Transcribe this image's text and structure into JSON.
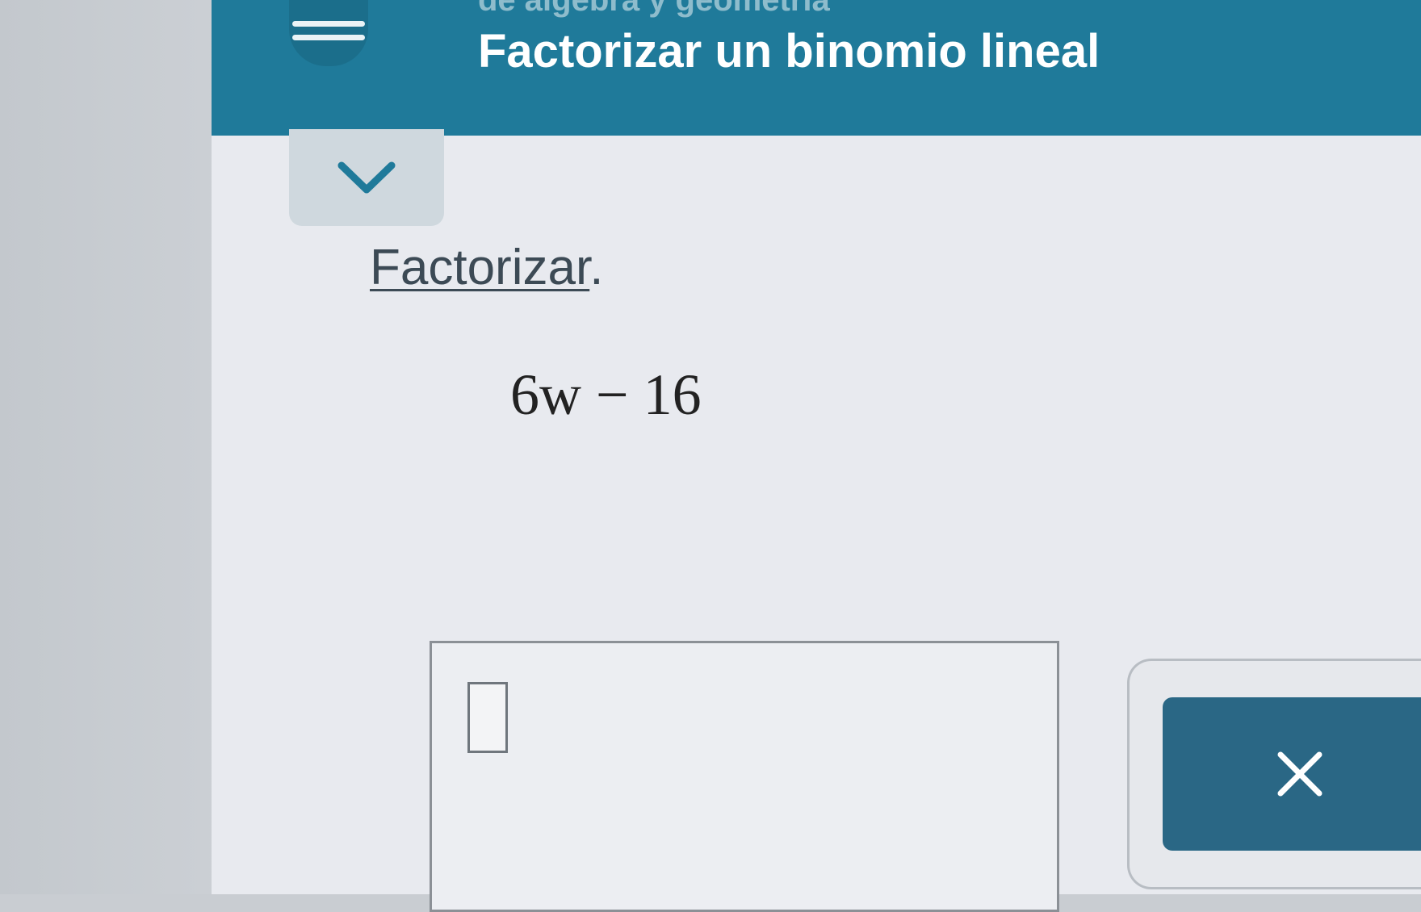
{
  "header": {
    "subject": "de álgebra y geometría",
    "lesson_title": "Factorizar un binomio lineal"
  },
  "problem": {
    "prompt_label": "Factorizar",
    "prompt_punct": ".",
    "expression": "6w − 16"
  },
  "icons": {
    "menu": "hamburger-menu-icon",
    "collapse": "chevron-down-icon",
    "clear": "close-x-icon"
  },
  "colors": {
    "header": "#1f7a9a",
    "button": "#2a6785",
    "background": "#e8eaef"
  }
}
